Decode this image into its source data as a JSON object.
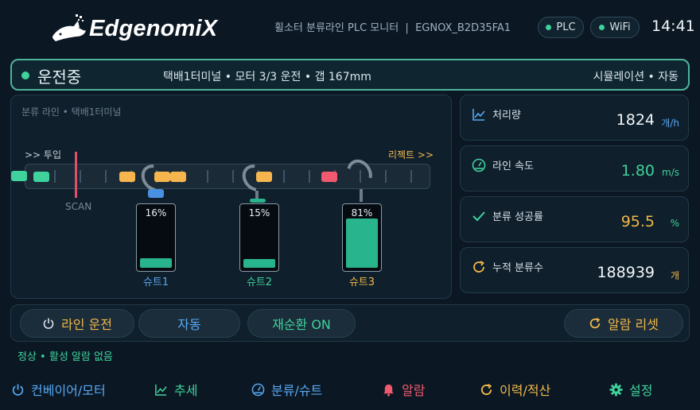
{
  "header": {
    "brand": "EdgenomiX",
    "subtitle": "휠소터 분류라인 PLC 모니터  |  EGNOX_B2D35FA1",
    "plc_label": "PLC",
    "wifi_label": "WiFi",
    "clock": "14:41"
  },
  "status": {
    "state": "운전중",
    "detail": "택배1터미널 • 모터 3/3 운전 • 갭 167mm",
    "mode": "시뮬레이션 • 자동"
  },
  "line": {
    "caption": "분류 라인 • 택배1터미널",
    "infeed_label": ">> 투입",
    "reject_label": "리젝트 >>",
    "scan_label": "SCAN",
    "chutes": [
      {
        "name": "슈트1",
        "fill_percent": 16,
        "percent_label": "16%",
        "tip_color": "#4a90e2",
        "name_color": "#58a8f2"
      },
      {
        "name": "슈트2",
        "fill_percent": 15,
        "percent_label": "15%",
        "tip_color": "#28b48c",
        "name_color": "#3fd29c"
      },
      {
        "name": "슈트3",
        "fill_percent": 81,
        "percent_label": "81%",
        "tip_color": "#7c8c98",
        "name_color": "#f2b84b"
      }
    ],
    "parcel_colors": {
      "green": "#3fd29c",
      "amber": "#f6b64d",
      "red": "#f05a6e"
    }
  },
  "metrics": [
    {
      "icon": "chart-line-icon",
      "label": "처리량",
      "value": "1824",
      "unit": "개/h",
      "value_color": "#f2f6f9",
      "unit_color": "#58a8f2"
    },
    {
      "icon": "speedometer-icon",
      "label": "라인 속도",
      "value": "1.80",
      "unit": "m/s",
      "value_color": "#3fd29c",
      "unit_color": "#3fd29c"
    },
    {
      "icon": "check-icon",
      "label": "분류 성공률",
      "value": "95.5",
      "unit": "%",
      "value_color": "#f2b84b",
      "unit_color": "#3fd29c"
    },
    {
      "icon": "refresh-icon",
      "label": "누적 분류수",
      "value": "188939",
      "unit": "개",
      "value_color": "#f2f6f9",
      "unit_color": "#f2b84b"
    }
  ],
  "controls": {
    "run_label": "라인 운전",
    "auto_label": "자동",
    "recirc_label": "재순환 ON",
    "reset_label": "알람 리셋"
  },
  "alarm_status": "정상 • 활성 알람 없음",
  "nav": [
    {
      "label": "컨베이어/모터",
      "color": "#58a8f2"
    },
    {
      "label": "추세",
      "color": "#3fd29c"
    },
    {
      "label": "분류/슈트",
      "color": "#58a8f2"
    },
    {
      "label": "알람",
      "color": "#f05a6e"
    },
    {
      "label": "이력/적산",
      "color": "#f2b84b"
    },
    {
      "label": "설정",
      "color": "#3fd29c"
    }
  ]
}
